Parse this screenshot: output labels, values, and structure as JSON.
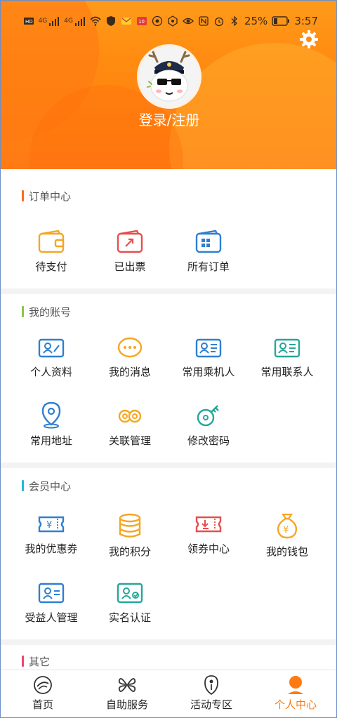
{
  "status_bar": {
    "battery": "25%",
    "time": "3:57",
    "signal1": "4G",
    "signal2": "4G"
  },
  "header": {
    "login_label": "登录/注册"
  },
  "sections": {
    "orders": {
      "title": "订单中心",
      "accent": "#ff6a1a",
      "items": [
        {
          "label": "待支付",
          "icon": "wallet-icon"
        },
        {
          "label": "已出票",
          "icon": "ticket-icon"
        },
        {
          "label": "所有订单",
          "icon": "orders-icon"
        }
      ]
    },
    "account": {
      "title": "我的账号",
      "accent": "#8bc34a",
      "items": [
        {
          "label": "个人资料",
          "icon": "profile-card-icon"
        },
        {
          "label": "我的消息",
          "icon": "message-icon"
        },
        {
          "label": "常用乘机人",
          "icon": "passenger-icon"
        },
        {
          "label": "常用联系人",
          "icon": "contact-icon"
        },
        {
          "label": "常用地址",
          "icon": "location-icon"
        },
        {
          "label": "关联管理",
          "icon": "link-icon"
        },
        {
          "label": "修改密码",
          "icon": "key-icon"
        }
      ]
    },
    "member": {
      "title": "会员中心",
      "accent": "#29b6d6",
      "items": [
        {
          "label": "我的优惠券",
          "icon": "coupon-icon"
        },
        {
          "label": "我的积分",
          "icon": "points-icon"
        },
        {
          "label": "领券中心",
          "icon": "coupon-center-icon"
        },
        {
          "label": "我的钱包",
          "icon": "money-bag-icon"
        },
        {
          "label": "受益人管理",
          "icon": "beneficiary-icon"
        },
        {
          "label": "实名认证",
          "icon": "id-verify-icon"
        }
      ]
    },
    "other": {
      "title": "其它",
      "accent": "#e94b6b"
    }
  },
  "tabbar": {
    "items": [
      {
        "label": "首页",
        "icon": "home-icon",
        "active": false
      },
      {
        "label": "自助服务",
        "icon": "self-service-icon",
        "active": false
      },
      {
        "label": "活动专区",
        "icon": "activity-icon",
        "active": false
      },
      {
        "label": "个人中心",
        "icon": "person-icon",
        "active": true
      }
    ],
    "active_color": "#ff7a10"
  }
}
